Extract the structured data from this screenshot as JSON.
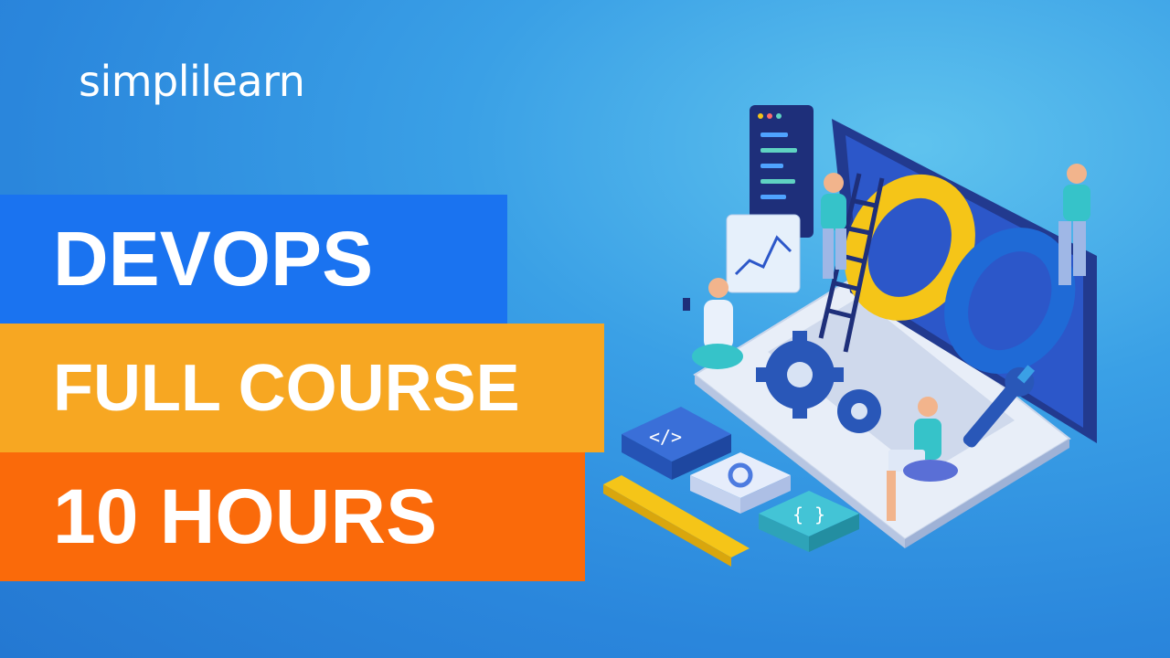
{
  "logo": {
    "text": "simplilearn"
  },
  "banners": [
    {
      "text": "DEVOPS",
      "color": "#1a73f0"
    },
    {
      "text": "FULL COURSE",
      "color": "#f7a722"
    },
    {
      "text": "10 HOURS",
      "color": "#fa6a0a"
    }
  ],
  "illustration": {
    "description_icon": "devops-laptop-illustration",
    "code_tile_text": "</>",
    "braces_tile_text": "{ }"
  },
  "colors": {
    "background": "#2a86dc",
    "blue_banner": "#1a73f0",
    "orange_banner": "#f7a722",
    "red_banner": "#fa6a0a",
    "infinity_yellow": "#f5c518",
    "infinity_blue": "#1f6ad6"
  }
}
